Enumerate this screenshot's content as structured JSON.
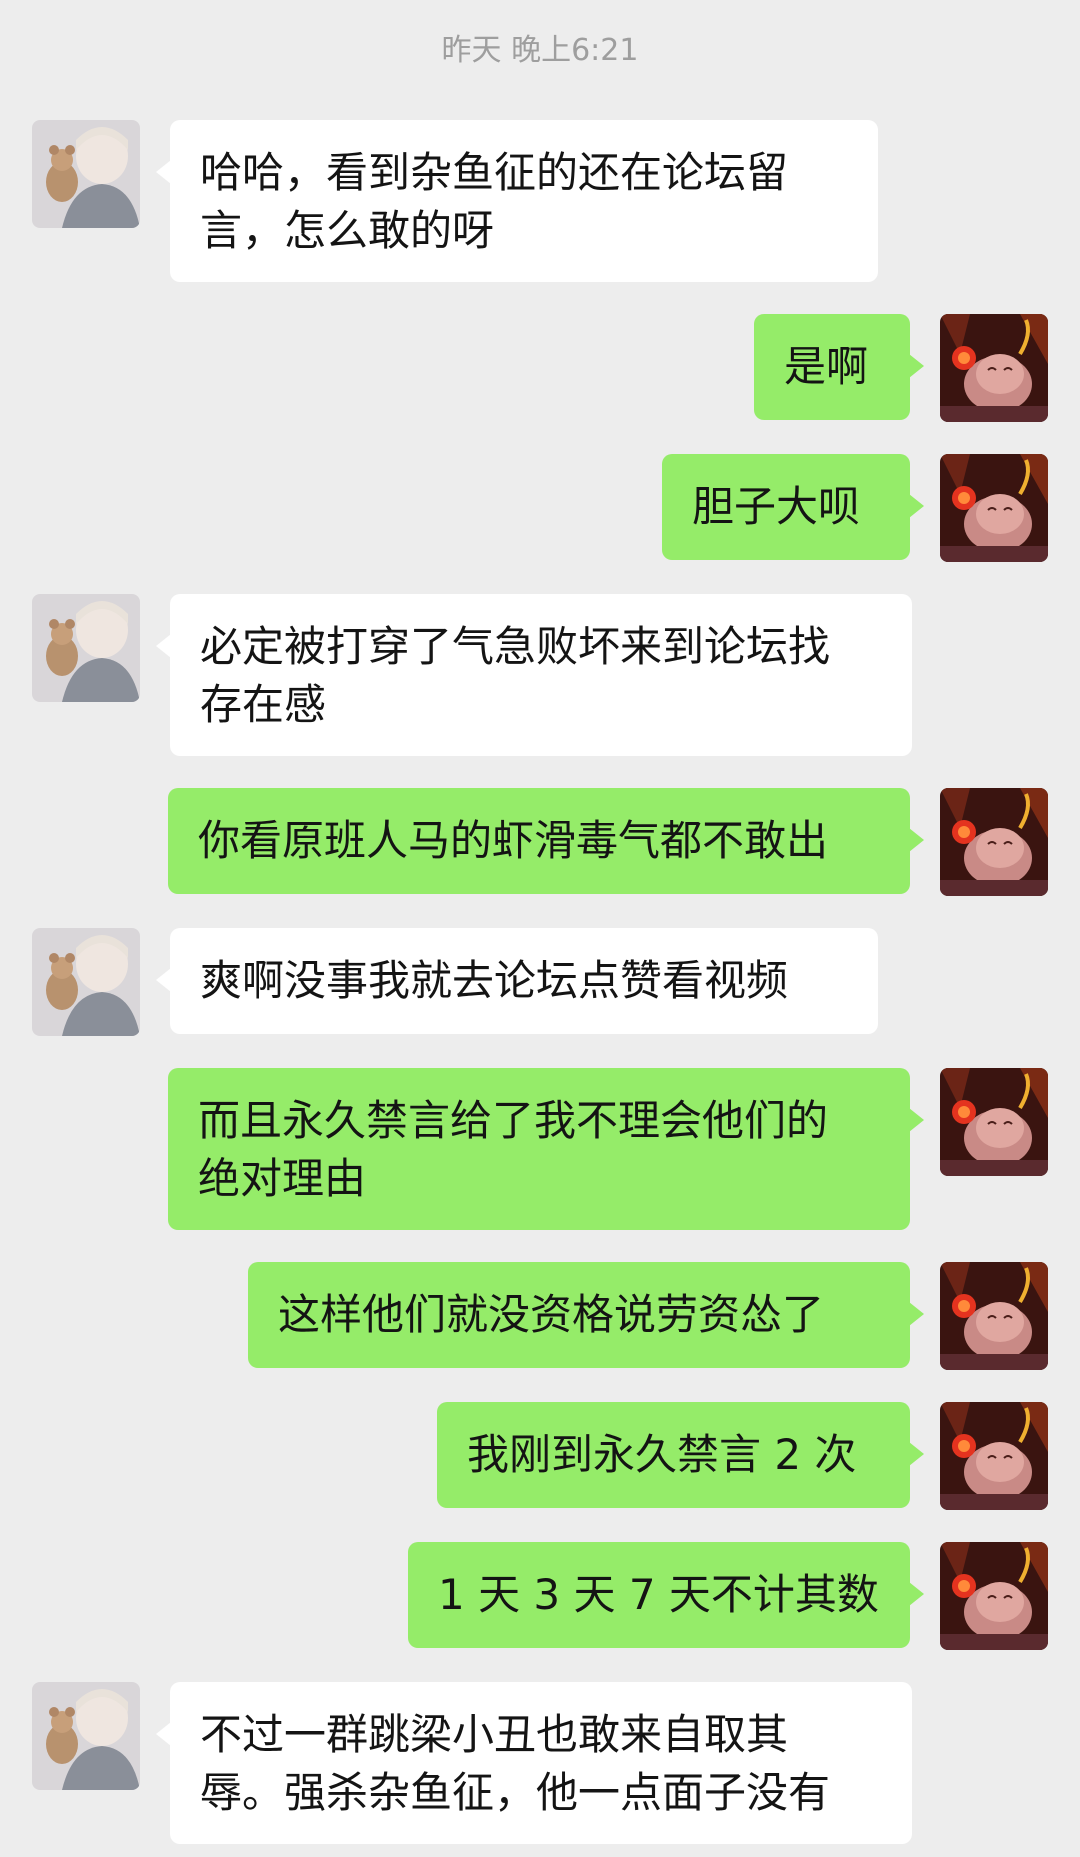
{
  "chat": {
    "timestamp": "昨天 晚上6:21",
    "messages": [
      {
        "side": "left",
        "text": "哈哈，看到杂鱼征的还在论坛留\n言，怎么敢的呀"
      },
      {
        "side": "right",
        "text": "是啊"
      },
      {
        "side": "right",
        "text": "胆子大呗"
      },
      {
        "side": "left",
        "text": "必定被打穿了气急败坏来到论坛找\n存在感"
      },
      {
        "side": "right",
        "text": "你看原班人马的虾滑毒气都不敢出"
      },
      {
        "side": "left",
        "text": "爽啊没事我就去论坛点赞看视频"
      },
      {
        "side": "right",
        "text": "而且永久禁言给了我不理会他们的\n绝对理由"
      },
      {
        "side": "right",
        "text": "这样他们就没资格说劳资怂了"
      },
      {
        "side": "right",
        "text": "我刚到永久禁言 2 次"
      },
      {
        "side": "right",
        "text": "1 天 3 天 7 天不计其数"
      },
      {
        "side": "left",
        "text": "不过一群跳梁小丑也敢来自取其\n辱。强杀杂鱼征，他一点面子没有"
      }
    ]
  },
  "avatars": {
    "left": "anime-character-holding-plush-avatar",
    "right": "demon-creature-fiery-avatar"
  },
  "colors": {
    "background": "#ededed",
    "left_bubble": "#ffffff",
    "right_bubble": "#95ec69",
    "timestamp_text": "#9e9e9e"
  }
}
